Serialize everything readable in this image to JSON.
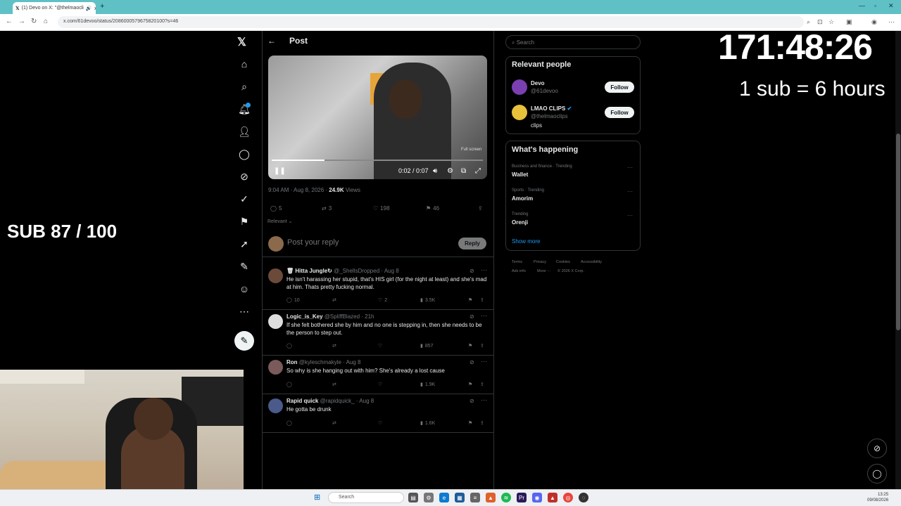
{
  "browser": {
    "tab_title": "(1) Devo on X: \"@thelmaocli",
    "url": "x.com/61devoo/status/2086000579675820100?s=46"
  },
  "stream_overlay": {
    "sub_counter": "SUB 87 / 100",
    "timer": "171:48:26",
    "sub_rule": "1 sub = 6 hours"
  },
  "post": {
    "header_title": "Post",
    "video_time": "0:02 / 0:07",
    "video_progress": 0.25,
    "fullscreen_tooltip": "Full screen",
    "time": "9:04 AM · Aug 8, 2026 · ",
    "views_count": "24.9K",
    "views_label": " Views",
    "stats": {
      "replies": "5",
      "reposts": "3",
      "likes": "198",
      "bookmarks": "46"
    },
    "sort_label": "Relevant"
  },
  "reply": {
    "placeholder": "Post your reply",
    "button_label": "Reply"
  },
  "comments": [
    {
      "name": "🗑 Hitta Jungle↻",
      "handle": "@_ShellsDropped · Aug 8",
      "text": "He isn't harassing her stupid, that's HIS girl (for the night at least) and she's mad at him. Thats pretty fucking normal.",
      "replies": "10",
      "likes": "2",
      "views": "3.5K",
      "avatar_color": "#6b4a3a"
    },
    {
      "name": "Logic_is_Key",
      "handle": "@SpliffBlazed · 21h",
      "text": "If she felt bothered she by him and no one is stepping in, then she needs to be the person to step out.",
      "replies": "",
      "likes": "",
      "views": "857",
      "avatar_color": "#dddddd"
    },
    {
      "name": "Ron",
      "handle": "@kyleschmakyle · Aug 8",
      "text": "So why is she hanging out with him? She's already a lost cause",
      "replies": "",
      "likes": "",
      "views": "1.9K",
      "avatar_color": "#7a5a5a"
    },
    {
      "name": "Rapid quick",
      "handle": "@rapidquick_ · Aug 8",
      "text": "He gotta be drunk",
      "replies": "",
      "likes": "",
      "views": "1.6K",
      "avatar_color": "#4a5a8a"
    }
  ],
  "sidebar_right": {
    "search_placeholder": "Search",
    "people_title": "Relevant people",
    "people": [
      {
        "name": "Devo",
        "handle": "@61devoo",
        "bio": "",
        "follow": "Follow",
        "avatar_color": "#7a3fb0"
      },
      {
        "name": "LMAO CLIPS",
        "handle": "@thelmaoclips",
        "bio": "clips",
        "follow": "Follow",
        "avatar_color": "#e8c23a"
      }
    ],
    "happening_title": "What's happening",
    "trends": [
      {
        "category": "Business and finance · Trending",
        "name": "Wallet"
      },
      {
        "category": "Sports · Trending",
        "name": "Amorim"
      },
      {
        "category": "Trending",
        "name": "Orenji"
      }
    ],
    "show_more": "Show more",
    "footer": [
      "Terms",
      "Privacy",
      "Cookies",
      "Accessibility",
      "Ads info",
      "More ···",
      "© 2026 X Corp."
    ]
  },
  "taskbar": {
    "search": "Search",
    "time": "13:25",
    "date": "09/08/2026"
  },
  "colors": {
    "accent": "#1d9bf0",
    "background": "#000000",
    "border": "#2f3336",
    "muted": "#71767b"
  }
}
